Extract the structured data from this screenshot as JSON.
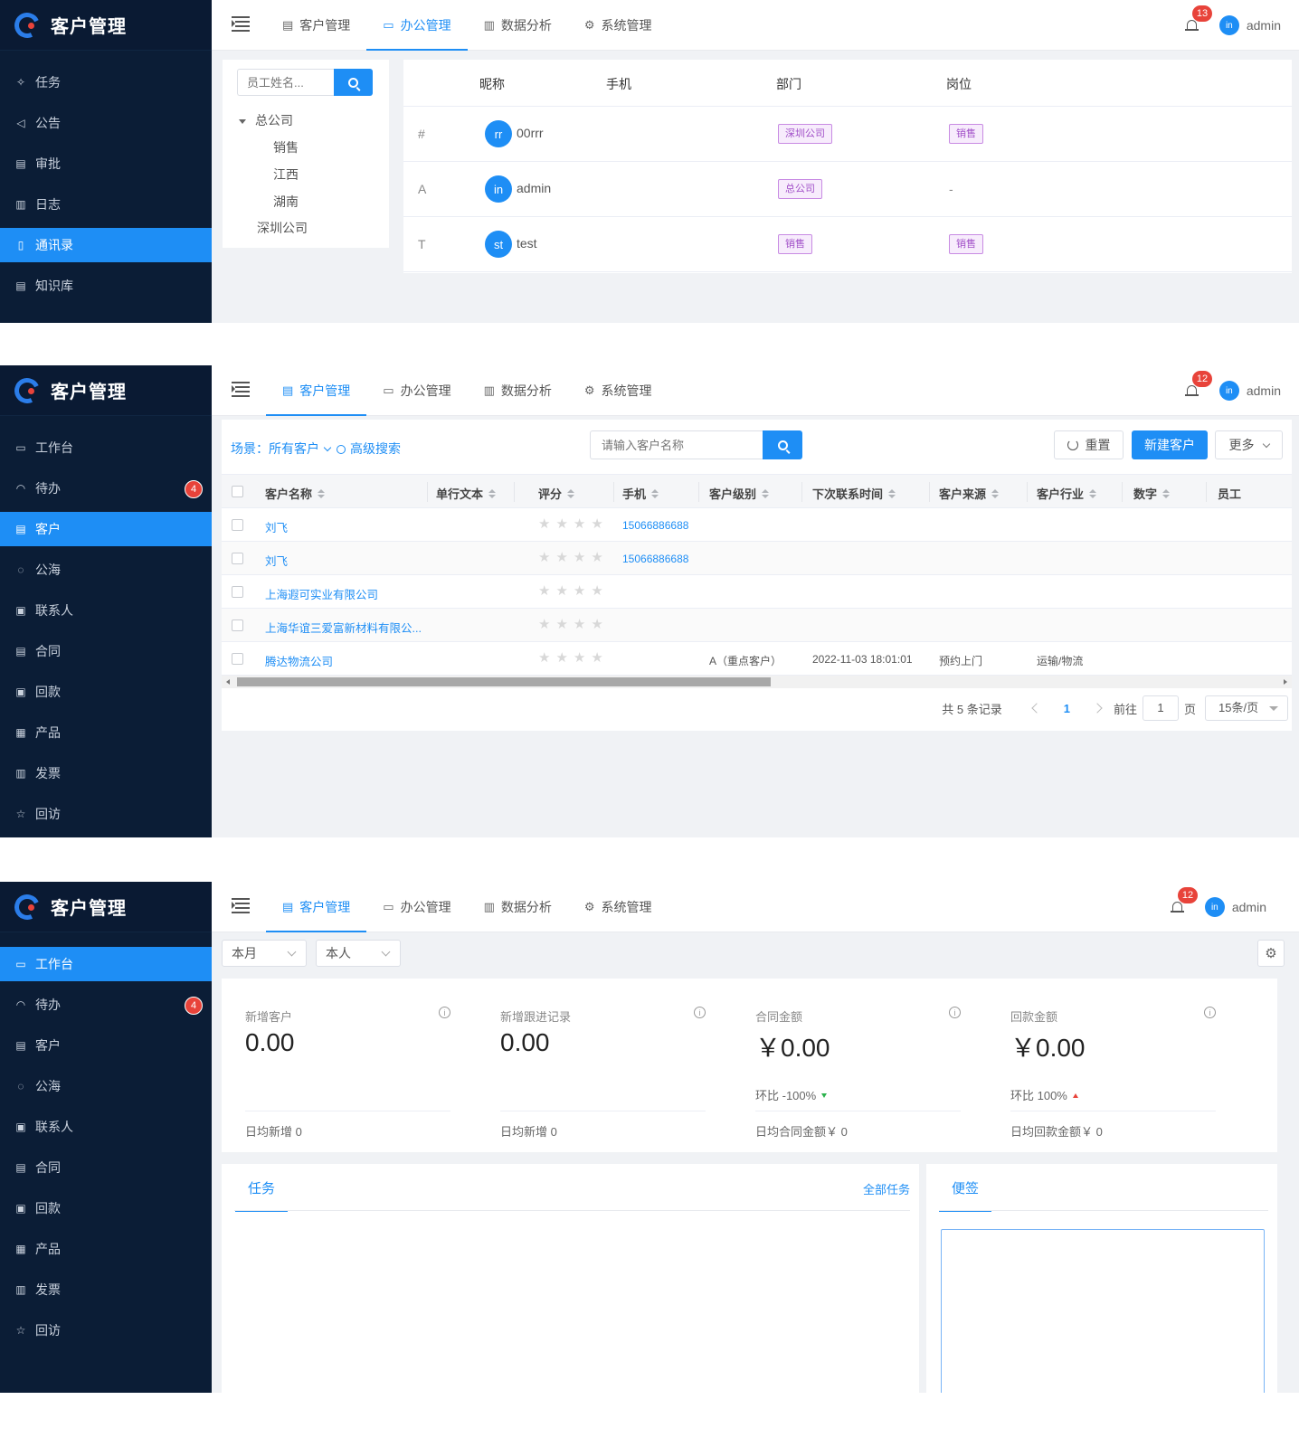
{
  "app": {
    "title": "客户管理",
    "user": "admin",
    "avatar_text": "in"
  },
  "nav": {
    "items": [
      "客户管理",
      "办公管理",
      "数据分析",
      "系统管理"
    ]
  },
  "panel1": {
    "notification_count": "13",
    "menu": [
      "任务",
      "公告",
      "审批",
      "日志",
      "通讯录",
      "知识库"
    ],
    "active_menu": "通讯录",
    "employee_search_placeholder": "员工姓名...",
    "tree": {
      "root": "总公司",
      "children": [
        "销售",
        "江西",
        "湖南"
      ],
      "sibling": "深圳公司"
    },
    "contacts_headers": [
      "昵称",
      "手机",
      "部门",
      "岗位"
    ],
    "contacts": [
      {
        "letter": "#",
        "avatar": "rr",
        "name": "00rrr",
        "dept": "深圳公司",
        "post": "销售"
      },
      {
        "letter": "A",
        "avatar": "in",
        "name": "admin",
        "dept": "总公司",
        "post": "-"
      },
      {
        "letter": "T",
        "avatar": "st",
        "name": "test",
        "dept": "销售",
        "post": "销售"
      }
    ]
  },
  "panel2": {
    "notification_count": "12",
    "menu": [
      "工作台",
      "待办",
      "客户",
      "公海",
      "联系人",
      "合同",
      "回款",
      "产品",
      "发票",
      "回访"
    ],
    "active_menu": "客户",
    "todo_badge": "4",
    "scene_label": "场景：所有客户",
    "advanced_search": "高级搜索",
    "customer_search_placeholder": "请输入客户名称",
    "buttons": {
      "reset": "重置",
      "new_customer": "新建客户",
      "more": "更多"
    },
    "columns": [
      "客户名称",
      "单行文本",
      "评分",
      "手机",
      "客户级别",
      "下次联系时间",
      "客户来源",
      "客户行业",
      "数字",
      "员工"
    ],
    "rows": [
      {
        "name": "刘飞",
        "phone": "15066886688",
        "level": "",
        "next_contact": "",
        "source": "",
        "industry": ""
      },
      {
        "name": "刘飞",
        "phone": "15066886688",
        "level": "",
        "next_contact": "",
        "source": "",
        "industry": ""
      },
      {
        "name": "上海遐可实业有限公司",
        "phone": "",
        "level": "",
        "next_contact": "",
        "source": "",
        "industry": ""
      },
      {
        "name": "上海华谊三爱富新材料有限公...",
        "phone": "",
        "level": "",
        "next_contact": "",
        "source": "",
        "industry": ""
      },
      {
        "name": "腾达物流公司",
        "phone": "",
        "level": "A（重点客户）",
        "next_contact": "2022-11-03 18:01:01",
        "source": "预约上门",
        "industry": "运输/物流"
      }
    ],
    "pagination": {
      "total": "共 5 条记录",
      "current": "1",
      "goto": "前往",
      "goto_value": "1",
      "page_unit": "页",
      "page_size": "15条/页"
    }
  },
  "panel3": {
    "notification_count": "12",
    "menu": [
      "工作台",
      "待办",
      "客户",
      "公海",
      "联系人",
      "合同",
      "回款",
      "产品",
      "发票",
      "回访"
    ],
    "active_menu": "工作台",
    "todo_badge": "4",
    "filters": [
      "本月",
      "本人"
    ],
    "stats": [
      {
        "label": "新增客户",
        "value": "0.00",
        "compare": "",
        "daily": "日均新增 0"
      },
      {
        "label": "新增跟进记录",
        "value": "0.00",
        "compare": "",
        "daily": "日均新增 0"
      },
      {
        "label": "合同金额",
        "value": "￥0.00",
        "compare": "环比 -100%",
        "trend": "down",
        "daily": "日均合同金额￥ 0"
      },
      {
        "label": "回款金额",
        "value": "￥0.00",
        "compare": "环比 100%",
        "trend": "up",
        "daily": "日均回款金额￥ 0"
      }
    ],
    "task_tab": "任务",
    "all_tasks": "全部任务",
    "note_tab": "便签"
  },
  "colors": {
    "primary": "#1e8ef5",
    "sidebar": "#0b1d36",
    "badge": "#e8433a",
    "tag_purple": "#a14fc8"
  }
}
